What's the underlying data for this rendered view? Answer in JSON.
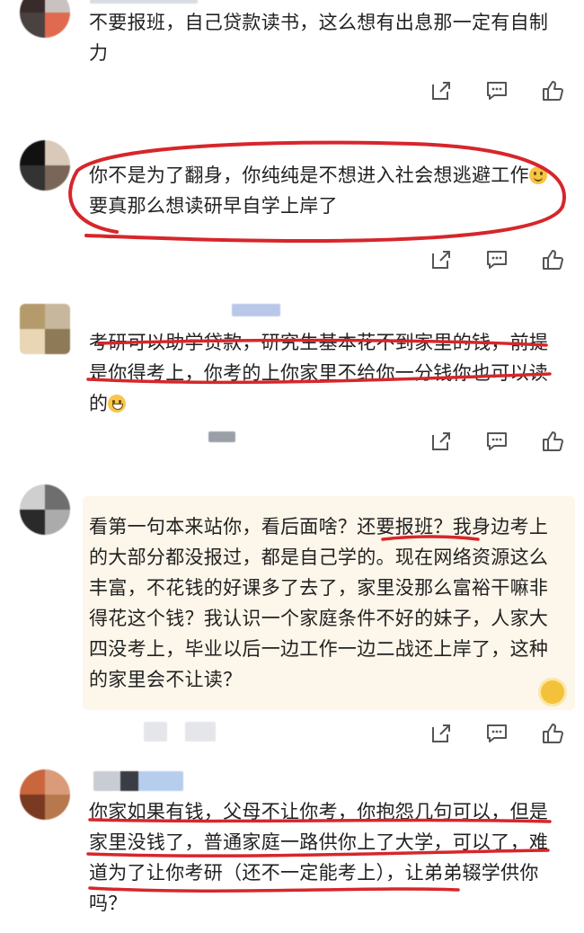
{
  "comments": [
    {
      "text": "不要报班，自己贷款读书，这么想有出息那一定有自制力"
    },
    {
      "text_before": "你不是为了翻身，你纯纯是不想进入社会想逃避工作",
      "text_after": "要真那么想读研早自学上岸了"
    },
    {
      "text": "考研可以助学贷款，研究生基本花不到家里的钱，前提是你得考上，你考的上你家里不给你一分钱你也可以读的"
    },
    {
      "text": "看第一句本来站你，看后面啥？还要报班？我身边考上的大部分都没报过，都是自己学的。现在网络资源这么丰富，不花钱的好课多了去了，家里没那么富裕干嘛非得花这个钱？我认识一个家庭条件不好的妹子，人家大四没考上，毕业以后一边工作一边二战还上岸了，这种的家里会不让读？"
    },
    {
      "text": "你家如果有钱，父母不让你考，你抱怨几句可以，但是家里没钱了，普通家庭一路供你上了大学，可以了，难道为了让你考研（还不一定能考上），让弟弟辍学供你吗？"
    }
  ],
  "actions": {
    "icons": [
      "share-icon",
      "comment-icon",
      "like-icon"
    ]
  },
  "colors": {
    "ink": "#d7262a",
    "highlight": "#fdf6ea",
    "icon": "#555555"
  }
}
